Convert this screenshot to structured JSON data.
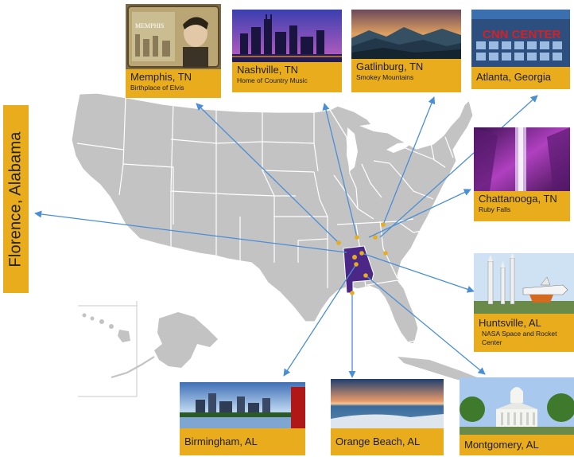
{
  "map": {
    "side_label": "Florence, Alabama",
    "colors": {
      "land": "#c3c3c3",
      "border": "#ffffff",
      "highlight_state": "#4b2887",
      "dot": "#e8ac1c",
      "arrow": "#4a8ed6",
      "caption_bg": "#e8ac1c"
    },
    "highlighted_state": "Alabama",
    "destinations": [
      {
        "id": "memphis",
        "title": "Memphis, TN",
        "subtitle": "Birthplace of Elvis",
        "icon": "elvis-photo"
      },
      {
        "id": "nashville",
        "title": "Nashville, TN",
        "subtitle": "Home of Country Music",
        "icon": "city-skyline-night-photo"
      },
      {
        "id": "gatlinburg",
        "title": "Gatlinburg, TN",
        "subtitle": "Smokey Mountains",
        "icon": "mountains-photo"
      },
      {
        "id": "atlanta",
        "title": "Atlanta, Georgia",
        "subtitle": "",
        "icon": "cnn-center-photo",
        "photo_text": "CNN CENTER"
      },
      {
        "id": "chattanooga",
        "title": "Chattanooga, TN",
        "subtitle": "Ruby Falls",
        "icon": "cave-waterfall-photo"
      },
      {
        "id": "huntsville",
        "title": "Huntsville, AL",
        "subtitle": "NASA Space and Rocket Center",
        "icon": "rockets-photo"
      },
      {
        "id": "montgomery",
        "title": "Montgomery, AL",
        "subtitle": "",
        "icon": "capitol-building-photo"
      },
      {
        "id": "orange-beach",
        "title": "Orange Beach, AL",
        "subtitle": "",
        "icon": "beach-sunset-photo"
      },
      {
        "id": "birmingham",
        "title": "Birmingham, AL",
        "subtitle": "",
        "icon": "city-skyline-photo"
      }
    ]
  }
}
